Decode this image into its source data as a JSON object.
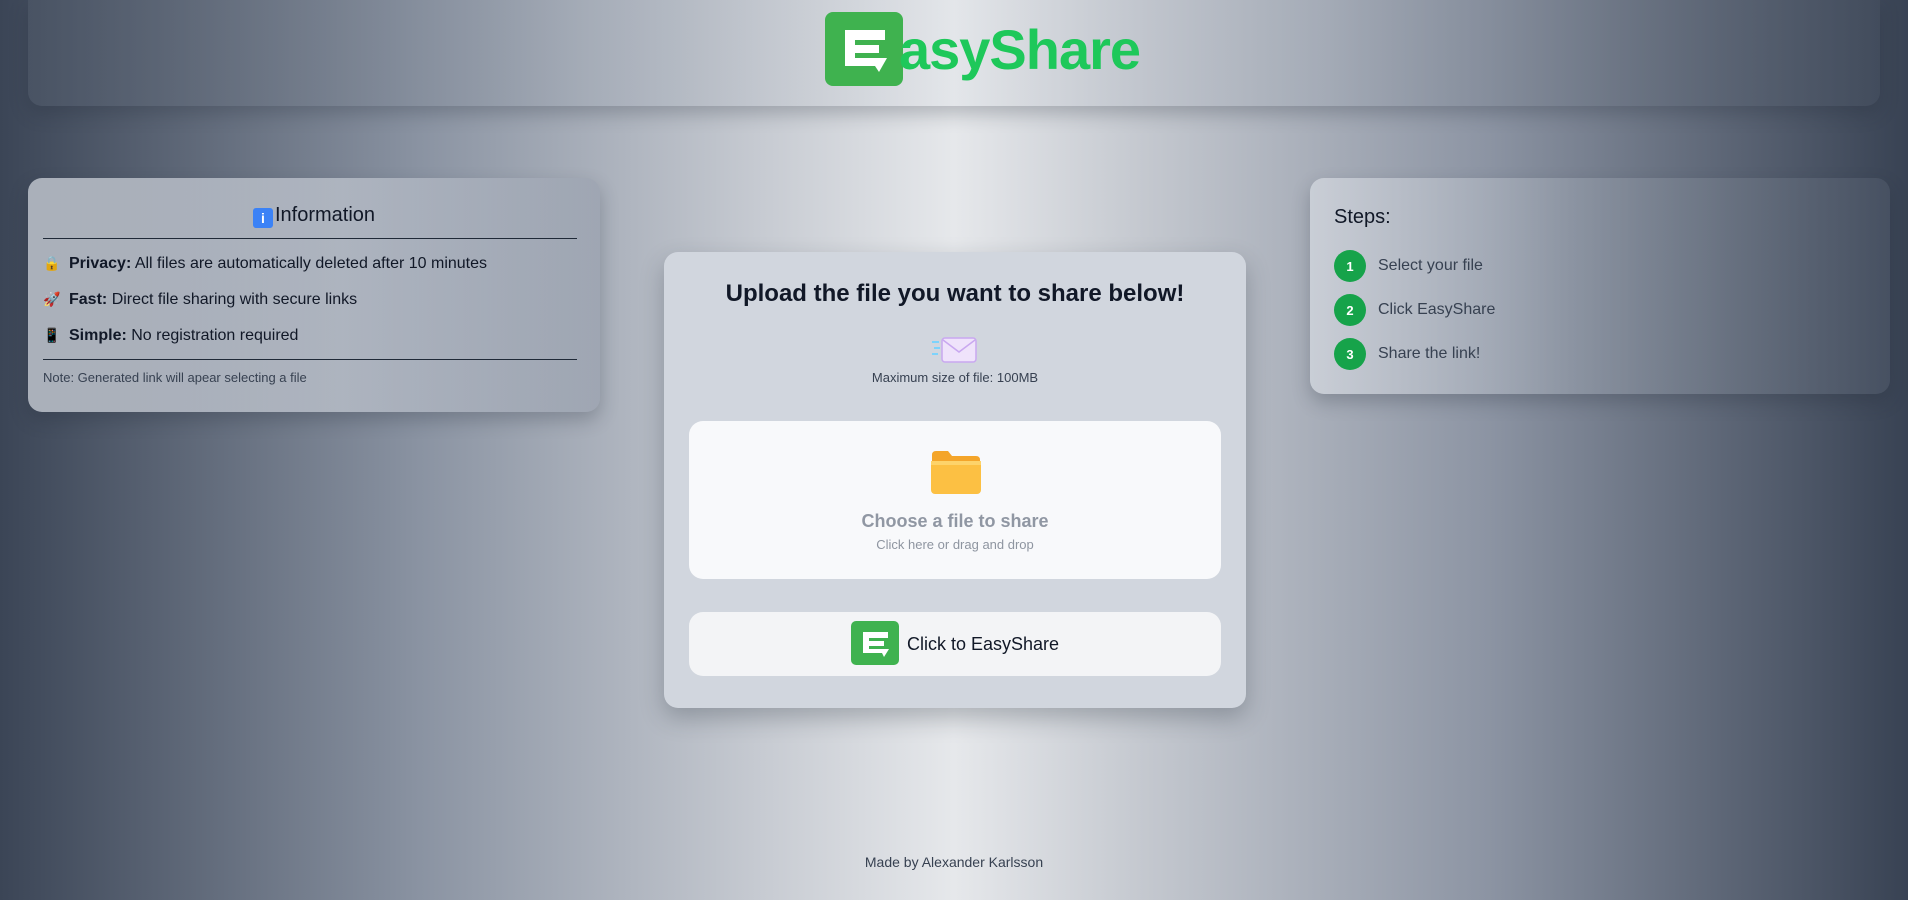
{
  "header": {
    "logo_text": "asyShare",
    "logo_icon": "easyshare-logo-icon",
    "brand_color": "#1ec85a"
  },
  "info": {
    "icon": "information-icon",
    "title": "Information",
    "items": [
      {
        "emoji": "🔒",
        "icon": "lock-icon",
        "label": "Privacy:",
        "text": "All files are automatically deleted after 10 minutes"
      },
      {
        "emoji": "🚀",
        "icon": "rocket-icon",
        "label": "Fast:",
        "text": "Direct file sharing with secure links"
      },
      {
        "emoji": "📱",
        "icon": "phone-icon",
        "label": "Simple:",
        "text": "No registration required"
      }
    ],
    "note": "Note: Generated link will apear selecting a file"
  },
  "steps": {
    "title": "Steps:",
    "items": [
      {
        "num": "1",
        "label": "Select your file"
      },
      {
        "num": "2",
        "label": "Click EasyShare"
      },
      {
        "num": "3",
        "label": "Share the link!"
      }
    ],
    "accent": "#16a34a"
  },
  "upload": {
    "title": "Upload the file you want to share below!",
    "mail_icon": "envelope-icon",
    "max_size": "Maximum size of file: 100MB",
    "drop_icon": "folder-icon",
    "drop_title": "Choose a file to share",
    "drop_sub": "Click here or drag and drop",
    "button_label": "Click to EasyShare"
  },
  "footer": {
    "text": "Made by Alexander Karlsson"
  }
}
